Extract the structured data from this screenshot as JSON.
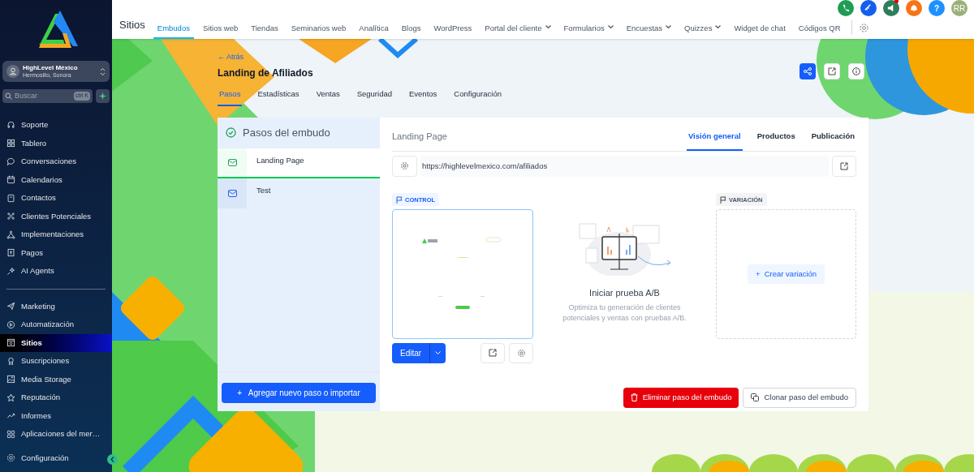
{
  "sidebar": {
    "account": {
      "name": "HighLevel México",
      "location": "Hermosillo, Sonora"
    },
    "search": {
      "placeholder": "Buscar",
      "shortcut": "ctrl K"
    },
    "sections": [
      [
        {
          "label": "Soporte",
          "selected": false
        },
        {
          "label": "Tablero",
          "selected": false
        },
        {
          "label": "Conversaciones",
          "selected": false
        },
        {
          "label": "Calendarios",
          "selected": false
        },
        {
          "label": "Contactos",
          "selected": false
        },
        {
          "label": "Clientes Potenciales",
          "selected": false
        },
        {
          "label": "Implementaciones",
          "selected": false
        },
        {
          "label": "Pagos",
          "selected": false
        },
        {
          "label": "AI Agents",
          "selected": false
        }
      ],
      [
        {
          "label": "Marketing",
          "selected": false
        },
        {
          "label": "Automatización",
          "selected": false
        },
        {
          "label": "Sitios",
          "selected": true
        },
        {
          "label": "Suscripciones",
          "selected": false
        },
        {
          "label": "Media Storage",
          "selected": false
        },
        {
          "label": "Reputación",
          "selected": false
        },
        {
          "label": "Informes",
          "selected": false
        },
        {
          "label": "Aplicaciones del mer…",
          "selected": false
        }
      ]
    ],
    "footer": {
      "label": "Configuración"
    }
  },
  "header_icons": [
    {
      "kind": "icon",
      "color": "#1f9d55",
      "badge": false
    },
    {
      "kind": "icon",
      "color": "#155eef",
      "badge": false
    },
    {
      "kind": "icon",
      "color": "#2f7d5b",
      "badge": true
    },
    {
      "kind": "icon",
      "color": "#f97316",
      "badge": false
    },
    {
      "kind": "help",
      "label": "?",
      "color": "#1e90ff",
      "badge": false
    },
    {
      "kind": "avatar",
      "label": "RR",
      "color": "#9bb07a",
      "badge": false
    }
  ],
  "topnav": {
    "title": "Sitios",
    "items": [
      {
        "label": "Embudos",
        "selected": true,
        "dropdown": false
      },
      {
        "label": "Sitios web",
        "selected": false,
        "dropdown": false
      },
      {
        "label": "Tiendas",
        "selected": false,
        "dropdown": false
      },
      {
        "label": "Seminarios web",
        "selected": false,
        "dropdown": false
      },
      {
        "label": "Analítica",
        "selected": false,
        "dropdown": false
      },
      {
        "label": "Blogs",
        "selected": false,
        "dropdown": false
      },
      {
        "label": "WordPress",
        "selected": false,
        "dropdown": false
      },
      {
        "label": "Portal del cliente",
        "selected": false,
        "dropdown": true
      },
      {
        "label": "Formularios",
        "selected": false,
        "dropdown": true
      },
      {
        "label": "Encuestas",
        "selected": false,
        "dropdown": true
      },
      {
        "label": "Quizzes",
        "selected": false,
        "dropdown": true
      },
      {
        "label": "Widget de chat",
        "selected": false,
        "dropdown": false
      },
      {
        "label": "Códigos QR",
        "selected": false,
        "dropdown": false
      }
    ]
  },
  "page": {
    "back": "← Atrás",
    "title": "Landing de Afiliados",
    "tabs": [
      {
        "label": "Pasos",
        "selected": true
      },
      {
        "label": "Estadísticas",
        "selected": false
      },
      {
        "label": "Ventas",
        "selected": false
      },
      {
        "label": "Seguridad",
        "selected": false
      },
      {
        "label": "Eventos",
        "selected": false
      },
      {
        "label": "Configuración",
        "selected": false
      }
    ]
  },
  "steps_panel": {
    "title": "Pasos del embudo",
    "steps": [
      {
        "label": "Landing Page",
        "selected": true
      },
      {
        "label": "Test",
        "selected": false
      }
    ],
    "add_button": "+   Agregar nuevo paso o importar"
  },
  "step_detail": {
    "name": "Landing Page",
    "tabs": [
      {
        "label": "Visión general",
        "selected": true
      },
      {
        "label": "Productos",
        "selected": false
      },
      {
        "label": "Publicación",
        "selected": false
      }
    ],
    "url": "https://highlevelmexico.com/afiliados",
    "control_label": "CONTROL",
    "edit_button": "Editar",
    "ab_title": "Iniciar prueba A/B",
    "ab_text": "Optimiza tu generación de clientes potenciales y ventas con pruebas A/B.",
    "variation_label": "VARIACIÓN",
    "create_variation": "+  Crear variación",
    "delete_button": "Eliminar paso del embudo",
    "clone_button": "Clonar paso del embudo"
  }
}
